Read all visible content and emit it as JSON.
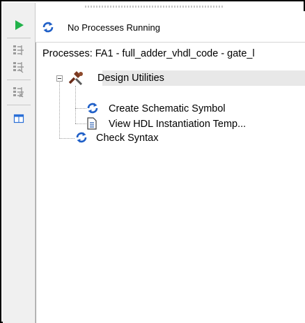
{
  "status": {
    "icon": "refresh-icon",
    "text": "No Processes Running"
  },
  "toolbar": {
    "items": [
      {
        "name": "run-button",
        "icon": "play-icon"
      },
      {
        "name": "rerun-button",
        "icon": "rerun-icon"
      },
      {
        "name": "rerun-all-button",
        "icon": "rerun-all-icon"
      },
      {
        "name": "stop-button",
        "icon": "stop-icon"
      },
      {
        "name": "view-button",
        "icon": "window-icon"
      }
    ]
  },
  "processes": {
    "header": "Processes: FA1 - full_adder_vhdl_code - gate_l",
    "tree": [
      {
        "label": "Design Utilities",
        "icon": "tools-icon",
        "expanded": true,
        "selected": true,
        "children": [
          {
            "label": "Create Schematic Symbol",
            "icon": "refresh-icon"
          },
          {
            "label": "View HDL Instantiation Temp...",
            "icon": "document-icon"
          }
        ]
      },
      {
        "label": "Check Syntax",
        "icon": "refresh-icon"
      }
    ]
  },
  "colors": {
    "play": "#21b24a",
    "refresh": "#1f5fc7",
    "selection": "#e8e8e8"
  }
}
